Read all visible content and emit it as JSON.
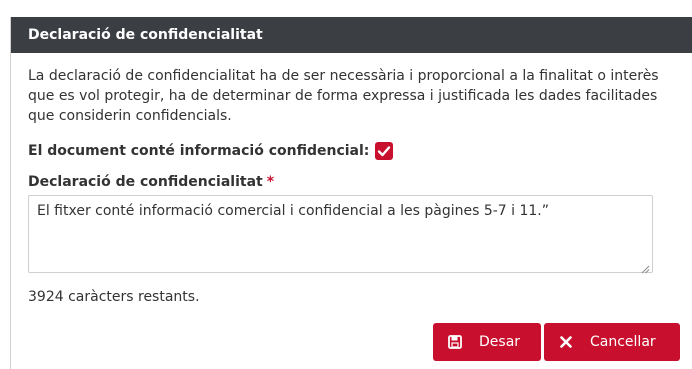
{
  "modal": {
    "title": "Declaració de confidencialitat",
    "intro": "La declaració de confidencialitat ha de ser necessària i proporcional a la finalitat o interès que es vol protegir, ha de determinar de forma expressa i justificada les dades facilitades que considerin confidencials.",
    "checkbox_label": "El document conté informació confidencial:",
    "checkbox_checked": true,
    "field_label": "Declaració de confidencialitat",
    "required_marker": "*",
    "textarea_value": "El fitxer conté informació comercial i confidencial a les pàgines 5-7 i 11.”",
    "counter_text": "3924 caràcters restants.",
    "buttons": {
      "save_label": "Desar",
      "save_icon": "floppy-disk-icon",
      "cancel_label": "Cancellar",
      "cancel_icon": "times-icon"
    }
  },
  "colors": {
    "header_bg": "#3b3f44",
    "accent": "#c8102e"
  }
}
